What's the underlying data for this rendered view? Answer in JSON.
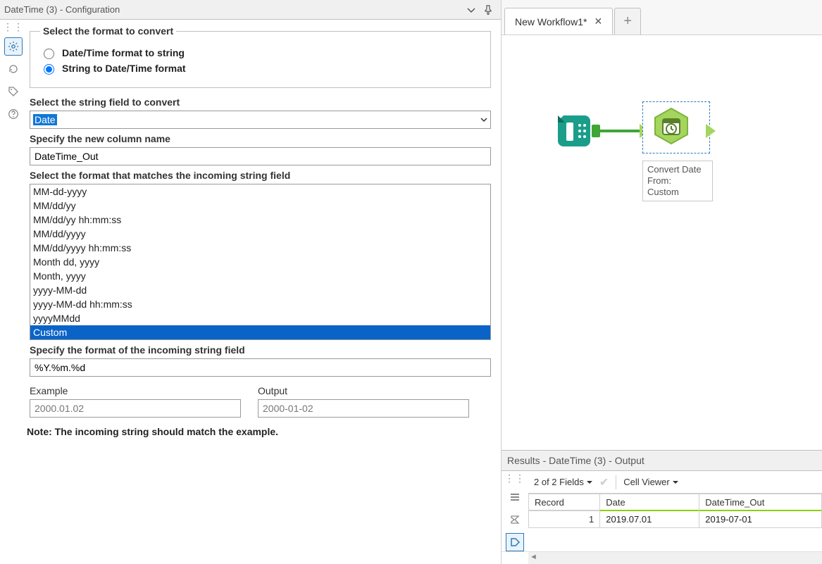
{
  "left": {
    "title": "DateTime (3) - Configuration",
    "format_group": {
      "legend": "Select the format to convert",
      "option1": "Date/Time format to string",
      "option2": "String to Date/Time format",
      "selected": 2
    },
    "string_field_label": "Select the string field to convert",
    "string_field_value": "Date",
    "new_col_label": "Specify the new column name",
    "new_col_value": "DateTime_Out",
    "format_list_label": "Select the format that matches the incoming string field",
    "format_items": [
      "MM-dd-yyyy",
      "MM/dd/yy",
      "MM/dd/yy hh:mm:ss",
      "MM/dd/yyyy",
      "MM/dd/yyyy hh:mm:ss",
      "Month dd, yyyy",
      "Month, yyyy",
      "yyyy-MM-dd",
      "yyyy-MM-dd hh:mm:ss",
      "yyyyMMdd",
      "Custom"
    ],
    "format_selected": "Custom",
    "custom_fmt_label": "Specify the format of the incoming string field",
    "custom_fmt_value": "%Y.%m.%d",
    "example_label": "Example",
    "example_value": "2000.01.02",
    "output_label": "Output",
    "output_value": "2000-01-02",
    "note": "Note: The incoming string should match the example."
  },
  "right": {
    "tab_name": "New Workflow1*",
    "node_label": "Convert Date\nFrom:\nCustom"
  },
  "results": {
    "title": "Results - DateTime (3) - Output",
    "fields_summary": "2 of 2 Fields",
    "cell_viewer": "Cell Viewer",
    "columns": [
      "Record",
      "Date",
      "DateTime_Out"
    ],
    "rows": [
      {
        "Record": "1",
        "Date": "2019.07.01",
        "DateTime_Out": "2019-07-01"
      }
    ]
  }
}
